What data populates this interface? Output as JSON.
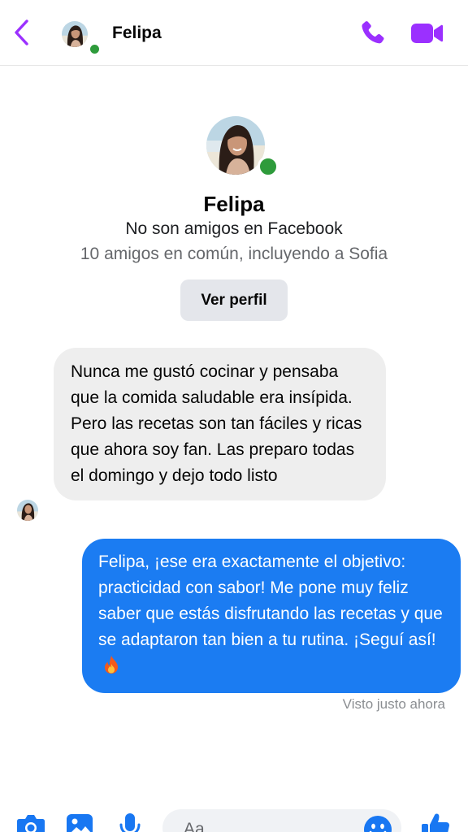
{
  "header": {
    "contact_name": "Felipa",
    "back_icon": "chevron-left-icon",
    "call_icon": "phone-icon",
    "video_icon": "video-camera-icon",
    "accent_color": "#9b30ff",
    "online_color": "#2e9b3b"
  },
  "profile": {
    "name": "Felipa",
    "relation": "No son amigos en Facebook",
    "mutual": "10 amigos en común, incluyendo a Sofia",
    "view_profile_label": "Ver perfil"
  },
  "messages": [
    {
      "direction": "incoming",
      "text": "Nunca me gustó cocinar y pensaba que la comida saludable era insípida. Pero las recetas son tan fáciles y ricas que ahora soy fan. Las preparo todas el domingo y dejo todo listo"
    },
    {
      "direction": "outgoing",
      "text": "Felipa, ¡ese era exactamente el objetivo: practicidad con sabor! Me pone muy feliz saber que estás disfrutando las recetas y que se adaptaron tan bien a tu rutina. ¡Seguí así!",
      "emoji": "fire-emoji",
      "bubble_color": "#1b7cf2"
    }
  ],
  "seen_status": "Visto justo ahora",
  "composer": {
    "placeholder": "Aa",
    "icons": [
      "camera-icon",
      "image-icon",
      "microphone-icon",
      "emoji-icon",
      "thumbs-up-icon"
    ]
  }
}
